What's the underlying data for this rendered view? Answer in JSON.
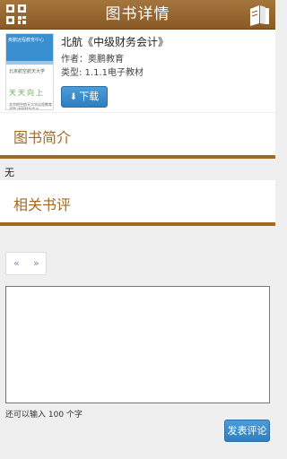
{
  "header": {
    "title": "图书详情",
    "left_icon": "qrcode-icon",
    "right_icon": "books-icon"
  },
  "book": {
    "title": "北航《中级财务会计》",
    "author": "作者：奥鹏教育",
    "type": "类型: 1.1.1电子教材",
    "download_label": "下载",
    "cover_text": [
      "奥鹏远程教育中心",
      "北京航空航天大学",
      "天天向上",
      "北京航空航天大学远程教育学院 中级财务会计"
    ]
  },
  "intro": {
    "heading": "图书简介",
    "text": "无"
  },
  "reviews": {
    "heading": "相关书评",
    "pager_prev": "«",
    "pager_next": "»"
  },
  "comment": {
    "value": "",
    "remaining": "还可以输入 100 个字",
    "submit_label": "发表评论"
  },
  "colors": {
    "header": "#9a6a33",
    "accent": "#a4691f",
    "button": "#3a8ccc"
  }
}
